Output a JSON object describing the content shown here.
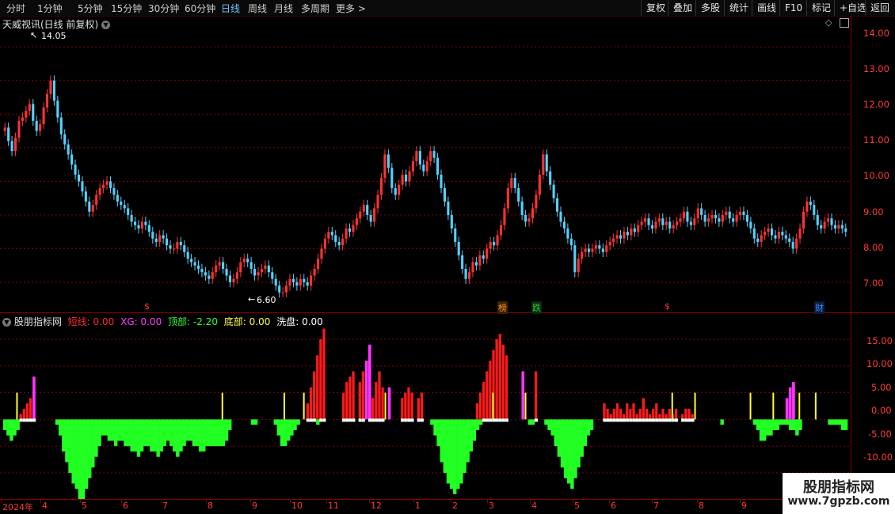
{
  "toolbar": {
    "periods": [
      "分时",
      "1分钟",
      "5分钟",
      "15分钟",
      "30分钟",
      "60分钟",
      "日线",
      "周线",
      "月线",
      "多周期",
      "更多 >"
    ],
    "active_period": "日线",
    "right_buttons": [
      "复权",
      "叠加",
      "多股",
      "统计",
      "画线",
      "F10",
      "标记",
      "+自选",
      "返回"
    ]
  },
  "main_panel": {
    "title": "天威视讯(日线 前复权)",
    "high_label": "14.05",
    "low_label": "6.60",
    "y_ticks": [
      "14.00",
      "13.00",
      "12.00",
      "11.00",
      "10.00",
      "9.00",
      "8.00",
      "7.00"
    ],
    "event_marks": [
      {
        "label": "$",
        "color": "#ff3333"
      },
      {
        "label": "榜",
        "color": "#ff8a2a"
      },
      {
        "label": "跌",
        "color": "#2ecc40"
      },
      {
        "label": "$",
        "color": "#ff3333"
      },
      {
        "label": "财",
        "color": "#3a8bff"
      }
    ]
  },
  "indicator_panel": {
    "name": "股朋指标网",
    "fields": [
      {
        "label": "短线:",
        "value": "0.00",
        "color": "#ff2a2a"
      },
      {
        "label": "XG:",
        "value": "0.00",
        "color": "#ff40ff"
      },
      {
        "label": "顶部:",
        "value": "-2.20",
        "color": "#33ff33"
      },
      {
        "label": "底部:",
        "value": "0.00",
        "color": "#ffff40"
      },
      {
        "label": "洗盘:",
        "value": "0.00",
        "color": "#ffffff"
      }
    ],
    "y_ticks": [
      "15.00",
      "10.00",
      "5.00",
      "0.00",
      "-5.00",
      "-10.00"
    ]
  },
  "x_axis": {
    "labels": [
      "2024年",
      "4",
      "5",
      "6",
      "7",
      "8",
      "9",
      "10",
      "11",
      "12",
      "1",
      "2",
      "3",
      "4",
      "5",
      "6",
      "7",
      "8",
      "9"
    ]
  },
  "watermark": {
    "title": "股朋指标网",
    "url": "www.7gpzb.com"
  },
  "chart_data": {
    "type": "candlestick",
    "price_range": [
      6.2,
      14.5
    ],
    "close_prices": [
      11.6,
      11.2,
      10.9,
      11.3,
      11.8,
      11.9,
      12.1,
      12.3,
      11.8,
      11.5,
      11.7,
      12.2,
      12.6,
      13.0,
      12.4,
      11.9,
      11.4,
      11.1,
      10.8,
      10.5,
      10.2,
      10.0,
      9.7,
      9.4,
      9.1,
      9.3,
      9.6,
      9.8,
      9.9,
      10.0,
      9.8,
      9.6,
      9.4,
      9.3,
      9.2,
      9.0,
      8.8,
      8.7,
      8.6,
      8.8,
      8.7,
      8.5,
      8.3,
      8.2,
      8.4,
      8.3,
      8.1,
      8.0,
      8.0,
      8.2,
      8.1,
      7.9,
      7.7,
      7.6,
      7.5,
      7.4,
      7.3,
      7.2,
      7.1,
      7.3,
      7.5,
      7.6,
      7.4,
      7.2,
      7.0,
      7.1,
      7.3,
      7.6,
      7.7,
      7.6,
      7.4,
      7.2,
      7.3,
      7.4,
      7.5,
      7.3,
      7.1,
      6.9,
      6.7,
      6.7,
      6.9,
      7.1,
      7.0,
      6.9,
      7.1,
      7.0,
      6.9,
      7.2,
      7.4,
      7.7,
      8.0,
      8.3,
      8.5,
      8.4,
      8.2,
      8.1,
      8.3,
      8.6,
      8.5,
      8.7,
      8.9,
      9.1,
      9.3,
      9.0,
      8.8,
      9.2,
      9.6,
      10.1,
      10.8,
      10.4,
      9.8,
      9.6,
      9.9,
      10.2,
      10.0,
      10.3,
      10.6,
      10.9,
      10.5,
      10.3,
      10.6,
      10.9,
      10.7,
      10.2,
      9.8,
      9.4,
      9.0,
      8.6,
      8.2,
      7.8,
      7.4,
      7.1,
      7.3,
      7.6,
      7.5,
      7.8,
      7.7,
      8.0,
      8.2,
      8.1,
      8.4,
      8.7,
      9.2,
      9.8,
      10.1,
      9.8,
      9.4,
      9.0,
      8.8,
      8.9,
      9.2,
      9.6,
      10.2,
      10.8,
      10.3,
      9.9,
      9.5,
      9.1,
      8.8,
      8.6,
      8.3,
      8.1,
      7.3,
      7.7,
      7.9,
      8.0,
      7.9,
      8.0,
      8.1,
      8.0,
      7.9,
      8.1,
      8.2,
      8.3,
      8.4,
      8.3,
      8.5,
      8.4,
      8.6,
      8.5,
      8.7,
      8.8,
      8.9,
      8.7,
      8.6,
      8.8,
      8.9,
      8.7,
      8.8,
      8.6,
      8.7,
      8.8,
      8.9,
      9.1,
      8.8,
      8.7,
      8.9,
      9.2,
      9.0,
      8.8,
      8.9,
      9.0,
      8.9,
      8.8,
      9.0,
      9.1,
      8.9,
      8.8,
      9.0,
      9.1,
      9.0,
      8.8,
      8.6,
      8.3,
      8.2,
      8.4,
      8.5,
      8.6,
      8.4,
      8.3,
      8.5,
      8.4,
      8.3,
      8.2,
      8.0,
      8.3,
      8.6,
      9.1,
      9.4,
      9.3,
      9.0,
      8.7,
      8.6,
      8.8,
      8.9,
      8.7,
      8.6,
      8.7,
      8.6,
      8.5
    ],
    "histogram_range": [
      -14,
      19
    ],
    "top_series": [
      -2,
      -3,
      -4,
      -3,
      -2,
      0,
      0,
      0,
      0,
      0,
      0,
      0,
      0,
      0,
      0,
      0,
      -1,
      -3,
      -6,
      -8,
      -10,
      -12,
      -13,
      -15,
      -15,
      -13,
      -11,
      -9,
      -7,
      -5,
      -3,
      -3,
      -4,
      -4,
      -5,
      -4,
      -4,
      -5,
      -5,
      -6,
      -6,
      -7,
      -6,
      -5,
      -5,
      -6,
      -6,
      -7,
      -6,
      -5,
      -4,
      -5,
      -6,
      -7,
      -6,
      -5,
      -4,
      -4,
      -5,
      -5,
      -6,
      -6,
      -5,
      -5,
      -5,
      -5,
      -5,
      -5,
      -4,
      -2,
      0,
      0,
      0,
      0,
      0,
      0,
      -1,
      -1,
      0,
      0,
      0,
      0,
      0,
      -1,
      -3,
      -5,
      -5,
      -4,
      -3,
      -2,
      -1,
      0,
      0,
      0,
      0,
      0,
      -1,
      0,
      0,
      0,
      0,
      0,
      0,
      0,
      0,
      0,
      0,
      0,
      0,
      0,
      0,
      0,
      0,
      0,
      0,
      0,
      0,
      0,
      0,
      0,
      0,
      0,
      0,
      0,
      0,
      0,
      0,
      0,
      0,
      0,
      0,
      -1,
      -3,
      -5,
      -8,
      -10,
      -12,
      -13,
      -14,
      -13,
      -12,
      -10,
      -8,
      -6,
      -4,
      -2,
      -1,
      0,
      0,
      0,
      0,
      0,
      0,
      0,
      0,
      0,
      0,
      0,
      0,
      0,
      0,
      -1,
      -1,
      0,
      0,
      0,
      -1,
      -2,
      -3,
      -5,
      -7,
      -9,
      -11,
      -12,
      -13,
      -11,
      -9,
      -7,
      -5,
      -3,
      -2,
      0,
      0,
      0,
      0,
      0,
      0,
      0,
      0,
      0,
      0,
      0,
      0,
      0,
      0,
      0,
      0,
      0,
      0,
      0,
      0,
      0,
      0,
      0,
      0,
      0,
      0,
      0,
      0,
      0,
      0,
      0,
      0,
      0,
      0,
      0,
      0,
      0,
      0,
      0,
      -1,
      0,
      0,
      0,
      0,
      0,
      0,
      0,
      0,
      0,
      -1,
      -2,
      -4,
      -4,
      -3,
      -3,
      -2,
      -2,
      -1,
      -1,
      -1,
      -2,
      -2,
      -3,
      -2,
      0,
      0,
      0,
      0,
      0,
      0,
      0,
      0,
      -1,
      -1,
      -1,
      -1,
      -2,
      -2
    ],
    "short_series": [
      0,
      0,
      0,
      0,
      0,
      1,
      2,
      3,
      4,
      5,
      0,
      0,
      0,
      0,
      0,
      0,
      0,
      0,
      0,
      0,
      0,
      0,
      0,
      0,
      0,
      0,
      0,
      0,
      0,
      0,
      0,
      0,
      0,
      0,
      0,
      0,
      0,
      0,
      0,
      0,
      0,
      0,
      0,
      0,
      0,
      0,
      0,
      0,
      0,
      0,
      0,
      0,
      0,
      0,
      0,
      0,
      0,
      0,
      0,
      0,
      0,
      0,
      0,
      0,
      0,
      0,
      0,
      0,
      0,
      0,
      0,
      0,
      0,
      0,
      0,
      0,
      0,
      0,
      0,
      0,
      0,
      0,
      0,
      0,
      0,
      0,
      0,
      0,
      0,
      0,
      0,
      0,
      0,
      3,
      6,
      9,
      12,
      15,
      17,
      0,
      0,
      0,
      0,
      0,
      5,
      7,
      8,
      9,
      0,
      7,
      9,
      0,
      2,
      4,
      7,
      9,
      6,
      0,
      0,
      0,
      0,
      0,
      4,
      5,
      6,
      5,
      0,
      4,
      5,
      0,
      0,
      0,
      0,
      0,
      0,
      0,
      0,
      0,
      0,
      0,
      0,
      0,
      0,
      0,
      0,
      3,
      5,
      7,
      9,
      11,
      13,
      15,
      16,
      14,
      12,
      0,
      0,
      0,
      0,
      0,
      0,
      0,
      0,
      9,
      0,
      0,
      0,
      0,
      0,
      0,
      0,
      0,
      0,
      0,
      0,
      0,
      0,
      0,
      0,
      0,
      0,
      0,
      0,
      0,
      3,
      2,
      1,
      2,
      3,
      2,
      1,
      3,
      2,
      3,
      1,
      2,
      4,
      2,
      1,
      2,
      3,
      1,
      2,
      1,
      2,
      1,
      2,
      0,
      1,
      2,
      2,
      1,
      0,
      0,
      0,
      0,
      0,
      0,
      0,
      0,
      0,
      0,
      0,
      0,
      0,
      0,
      0,
      0,
      0,
      0,
      0,
      0,
      0,
      0,
      0,
      0,
      0,
      0,
      0,
      0,
      0,
      0,
      0,
      0,
      0,
      0,
      0,
      0,
      0,
      0,
      0,
      0,
      0,
      0,
      0
    ],
    "xg_series": [
      0,
      0,
      0,
      0,
      0,
      0,
      0,
      0,
      0,
      8,
      0,
      0,
      0,
      0,
      0,
      0,
      0,
      0,
      0,
      0,
      0,
      0,
      0,
      0,
      0,
      0,
      0,
      0,
      0,
      0,
      0,
      0,
      0,
      0,
      0,
      0,
      0,
      0,
      0,
      0,
      0,
      0,
      0,
      0,
      0,
      0,
      0,
      0,
      0,
      0,
      0,
      0,
      0,
      0,
      0,
      0,
      0,
      0,
      0,
      0,
      0,
      0,
      0,
      0,
      0,
      0,
      0,
      0,
      0,
      0,
      0,
      0,
      0,
      0,
      0,
      0,
      0,
      0,
      0,
      0,
      0,
      0,
      0,
      0,
      0,
      0,
      0,
      0,
      0,
      0,
      0,
      0,
      0,
      0,
      0,
      0,
      0,
      0,
      0,
      0,
      0,
      0,
      0,
      0,
      0,
      0,
      0,
      0,
      0,
      0,
      0,
      11,
      14,
      0,
      0,
      0,
      0,
      0,
      6,
      0,
      0,
      0,
      0,
      0,
      0,
      0,
      0,
      0,
      0,
      0,
      0,
      0,
      0,
      0,
      0,
      0,
      0,
      0,
      0,
      0,
      0,
      0,
      0,
      0,
      0,
      0,
      0,
      0,
      0,
      0,
      0,
      0,
      0,
      0,
      0,
      0,
      0,
      0,
      0,
      9,
      0,
      0,
      0,
      0,
      0,
      0,
      0,
      0,
      0,
      0,
      0,
      0,
      0,
      0,
      0,
      0,
      0,
      0,
      0,
      0,
      0,
      0,
      0,
      0,
      0,
      0,
      0,
      0,
      0,
      0,
      0,
      0,
      0,
      0,
      0,
      0,
      0,
      0,
      0,
      0,
      0,
      0,
      0,
      0,
      0,
      0,
      0,
      0,
      0,
      0,
      0,
      0,
      0,
      0,
      0,
      0,
      0,
      0,
      0,
      0,
      0,
      0,
      0,
      0,
      0,
      0,
      0,
      0,
      0,
      0,
      0,
      0,
      0,
      0,
      0,
      0,
      0,
      0,
      0,
      0,
      4,
      6,
      7,
      0,
      0,
      0,
      0,
      0,
      0,
      0,
      0,
      0,
      0,
      0,
      0
    ],
    "bottom_signal_index": [
      4,
      67,
      86,
      92,
      117,
      150,
      160,
      205,
      212,
      229,
      236,
      244,
      249,
      263
    ],
    "wash_signal_value": 5,
    "colors": {
      "up": "#ff3232",
      "down": "#54d2ff",
      "short": "#ff1a1a",
      "xg": "#ff33ff",
      "top": "#22ff22",
      "bottom": "#ffff33",
      "wash": "#ffffff",
      "grid": "#8b0000"
    }
  }
}
